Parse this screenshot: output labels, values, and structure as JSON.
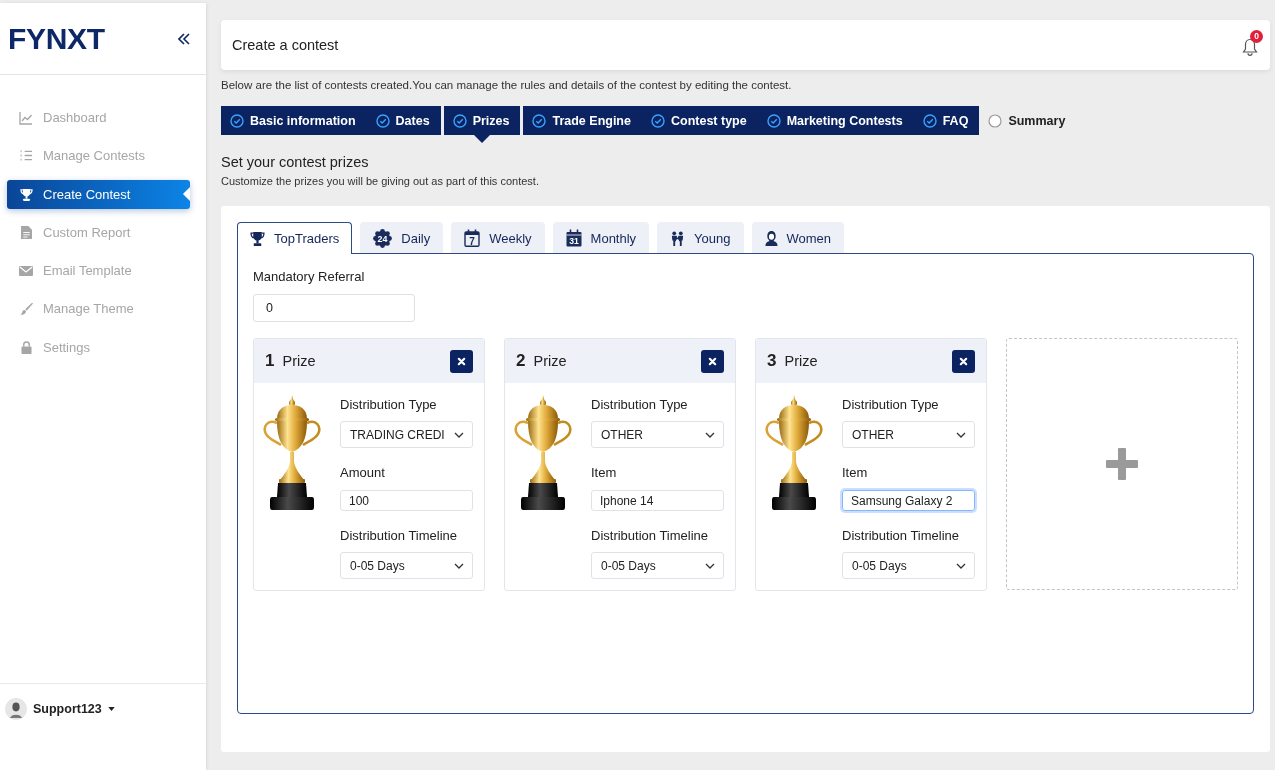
{
  "sidebar": {
    "logo": "FYNXT",
    "items": [
      {
        "label": "Dashboard",
        "kind": "chart",
        "selected": false
      },
      {
        "label": "Manage Contests",
        "kind": "list",
        "selected": false
      },
      {
        "label": "Create Contest",
        "kind": "trophy",
        "selected": true
      },
      {
        "label": "Custom Report",
        "kind": "document",
        "selected": false
      },
      {
        "label": "Email Template",
        "kind": "envelope",
        "selected": false
      },
      {
        "label": "Manage Theme",
        "kind": "brush",
        "selected": false
      },
      {
        "label": "Settings",
        "kind": "lock",
        "selected": false
      }
    ],
    "user": {
      "name": "Support123"
    }
  },
  "header": {
    "title": "Create a contest",
    "notifications": "0"
  },
  "intro": "Below are the list of contests created.You can manage the rules and details of the contest by editing the contest.",
  "steps": [
    {
      "label": "Basic information",
      "done": true,
      "selected": false
    },
    {
      "label": "Dates",
      "done": true,
      "selected": false
    },
    {
      "label": "Prizes",
      "done": true,
      "selected": true
    },
    {
      "label": "Trade Engine",
      "done": true,
      "selected": false
    },
    {
      "label": "Contest type",
      "done": true,
      "selected": false
    },
    {
      "label": "Marketing Contests",
      "done": true,
      "selected": false
    },
    {
      "label": "FAQ",
      "done": true,
      "selected": false
    },
    {
      "label": "Summary",
      "done": false,
      "selected": false
    }
  ],
  "section": {
    "title": "Set your contest prizes",
    "subtitle": "Customize the prizes you will be giving out as part of this contest."
  },
  "prize_tabs": [
    {
      "label": "TopTraders",
      "kind": "trophy",
      "selected": true
    },
    {
      "label": "Daily",
      "kind": "cog",
      "badge": "24",
      "selected": false
    },
    {
      "label": "Weekly",
      "kind": "calendar",
      "badge": "7",
      "selected": false
    },
    {
      "label": "Monthly",
      "kind": "calendar-filled",
      "badge": "31",
      "selected": false
    },
    {
      "label": "Young",
      "kind": "people",
      "selected": false
    },
    {
      "label": "Women",
      "kind": "person",
      "selected": false
    }
  ],
  "mandatory_referral": {
    "label": "Mandatory Referral",
    "value": "0"
  },
  "prizes": [
    {
      "rank": "1",
      "title": "Prize",
      "fields": [
        {
          "kind": "select",
          "label": "Distribution Type",
          "value": "TRADING CREDI",
          "focused": false
        },
        {
          "kind": "input",
          "label": "Amount",
          "value": "100",
          "focused": false
        },
        {
          "kind": "select",
          "label": "Distribution Timeline",
          "value": "0-05 Days",
          "focused": false
        }
      ]
    },
    {
      "rank": "2",
      "title": "Prize",
      "fields": [
        {
          "kind": "select",
          "label": "Distribution Type",
          "value": "OTHER",
          "focused": false
        },
        {
          "kind": "input",
          "label": "Item",
          "value": "Iphone 14",
          "focused": false
        },
        {
          "kind": "select",
          "label": "Distribution Timeline",
          "value": "0-05 Days",
          "focused": false
        }
      ]
    },
    {
      "rank": "3",
      "title": "Prize",
      "fields": [
        {
          "kind": "select",
          "label": "Distribution Type",
          "value": "OTHER",
          "focused": false
        },
        {
          "kind": "input",
          "label": "Item",
          "value": "Samsung Galaxy 2",
          "focused": true
        },
        {
          "kind": "select",
          "label": "Distribution Timeline",
          "value": "0-05 Days",
          "focused": false
        }
      ]
    }
  ]
}
